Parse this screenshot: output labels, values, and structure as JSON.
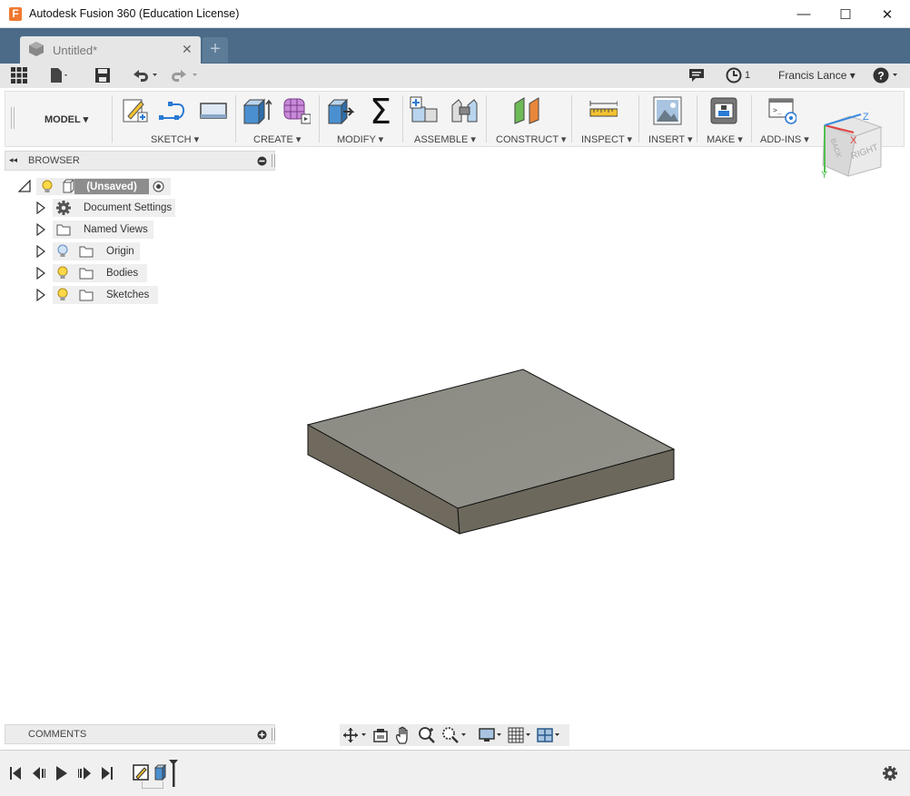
{
  "window": {
    "title": "Autodesk Fusion 360 (Education License)",
    "minimize": "—",
    "maximize": "☐",
    "close": "✕"
  },
  "tabs": {
    "doc_label": "Untitled*",
    "close": "✕",
    "new": "+"
  },
  "quick_access": {
    "notifications_count": "1",
    "user_name": "Francis Lance ▾",
    "help": "?"
  },
  "ribbon": {
    "workspace": "MODEL",
    "groups": [
      "SKETCH",
      "CREATE",
      "MODIFY",
      "ASSEMBLE",
      "CONSTRUCT",
      "INSPECT",
      "INSERT",
      "MAKE",
      "ADD-INS"
    ]
  },
  "browser": {
    "title": "BROWSER",
    "root": "(Unsaved)",
    "items": [
      "Document Settings",
      "Named Views",
      "Origin",
      "Bodies",
      "Sketches"
    ]
  },
  "viewcube": {
    "right": "RIGHT",
    "back": "BACK",
    "axis_x": "X",
    "axis_y": "Y",
    "axis_z": "Z"
  },
  "comments": {
    "title": "COMMENTS"
  },
  "colors": {
    "tabbar": "#4b6b89",
    "body_top": "#8e8e86",
    "body_side": "#6e6a5e",
    "accent": "#f07830"
  }
}
